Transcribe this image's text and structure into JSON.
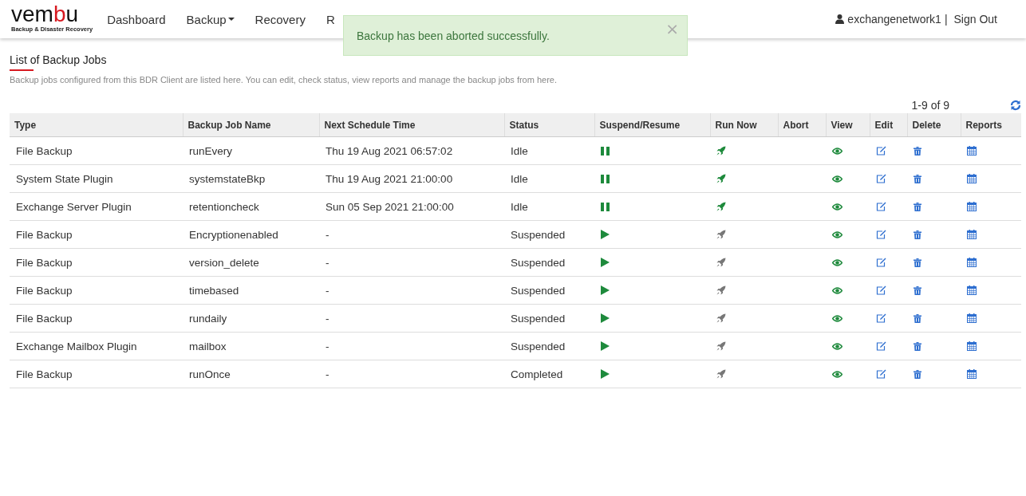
{
  "header": {
    "logo": {
      "parts": [
        {
          "text": "vem",
          "accent": false
        },
        {
          "text": "b",
          "accent": true
        },
        {
          "text": "u",
          "accent": false
        }
      ],
      "tagline": "Backup & Disaster Recovery"
    },
    "nav": [
      {
        "label": "Dashboard",
        "dropdown": false
      },
      {
        "label": "Backup",
        "dropdown": true
      },
      {
        "label": "Recovery",
        "dropdown": false
      },
      {
        "label": "R",
        "dropdown": false
      }
    ],
    "user": "exchangenetwork1",
    "separator": "|",
    "sign_out": "Sign Out"
  },
  "toast": {
    "message": "Backup has been aborted successfully.",
    "close": "×"
  },
  "section": {
    "title": "List of Backup Jobs",
    "description": "Backup jobs configured from this BDR Client are listed here. You can edit, check status, view reports and manage the backup jobs from here."
  },
  "pagination": "1-9 of 9",
  "table": {
    "columns": [
      "Type",
      "Backup Job Name",
      "Next Schedule Time",
      "Status",
      "Suspend/Resume",
      "Run Now",
      "Abort",
      "View",
      "Edit",
      "Delete",
      "Reports"
    ],
    "rows": [
      {
        "type": "File Backup",
        "name": "runEvery",
        "next": "Thu 19 Aug 2021 06:57:02",
        "status": "Idle",
        "resumable": false,
        "run_enabled": true
      },
      {
        "type": "System State Plugin",
        "name": "systemstateBkp",
        "next": "Thu 19 Aug 2021 21:00:00",
        "status": "Idle",
        "resumable": false,
        "run_enabled": true
      },
      {
        "type": "Exchange Server Plugin",
        "name": "retentioncheck",
        "next": "Sun 05 Sep 2021 21:00:00",
        "status": "Idle",
        "resumable": false,
        "run_enabled": true
      },
      {
        "type": "File Backup",
        "name": "Encryptionenabled",
        "next": "-",
        "status": "Suspended",
        "resumable": true,
        "run_enabled": false
      },
      {
        "type": "File Backup",
        "name": "version_delete",
        "next": "-",
        "status": "Suspended",
        "resumable": true,
        "run_enabled": false
      },
      {
        "type": "File Backup",
        "name": "timebased",
        "next": "-",
        "status": "Suspended",
        "resumable": true,
        "run_enabled": false
      },
      {
        "type": "File Backup",
        "name": "rundaily",
        "next": "-",
        "status": "Suspended",
        "resumable": true,
        "run_enabled": false
      },
      {
        "type": "Exchange Mailbox Plugin",
        "name": "mailbox",
        "next": "-",
        "status": "Suspended",
        "resumable": true,
        "run_enabled": false
      },
      {
        "type": "File Backup",
        "name": "runOnce",
        "next": "-",
        "status": "Completed",
        "resumable": true,
        "run_enabled": false
      }
    ]
  }
}
